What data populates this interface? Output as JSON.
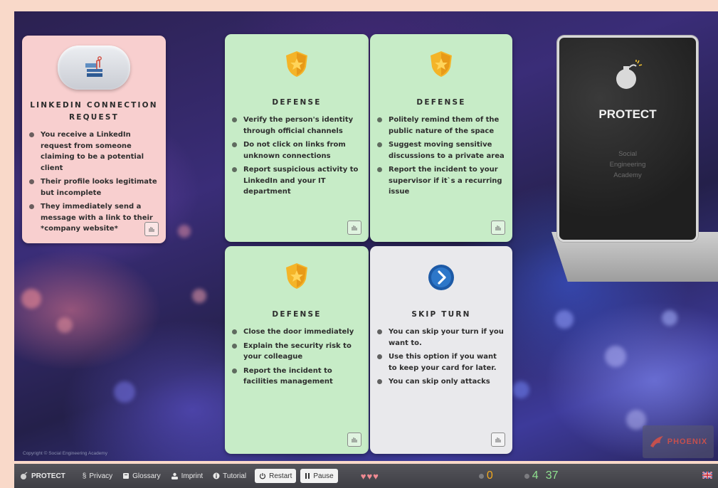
{
  "cards": {
    "attack": {
      "title": "LINKEDIN CONNECTION REQUEST",
      "bullets": [
        "You receive a LinkedIn request from someone claiming to be a potential client",
        "Their profile looks legitimate but incomplete",
        "They immediately send a message with a link to their *company website*"
      ]
    },
    "defense1": {
      "title": "DEFENSE",
      "bullets": [
        "Verify the person's identity through official channels",
        "Do not click on links from unknown connections",
        "Report suspicious activity to LinkedIn and your IT department"
      ]
    },
    "defense2": {
      "title": "DEFENSE",
      "bullets": [
        "Politely remind them of the public nature of the space",
        "Suggest moving sensitive discussions to a private area",
        "Report the incident to your supervisor if it`s a recurring issue"
      ]
    },
    "defense3": {
      "title": "DEFENSE",
      "bullets": [
        "Close the door immediately",
        "Explain the security risk to your colleague",
        "Report the incident to facilities management"
      ]
    },
    "skip": {
      "title": "SKIP TURN",
      "bullets": [
        "You can skip your turn if you want to.",
        "Use this option if you want to keep your card for later.",
        "You can skip only attacks"
      ]
    }
  },
  "deck": {
    "title": "PROTECT",
    "subtitle_lines": [
      "Social",
      "Engineering",
      "Academy"
    ]
  },
  "footer": {
    "copyright": "Copyright © Social Engineering Academy",
    "logo_text": "PHOENIX"
  },
  "bottombar": {
    "brand": "PROTECT",
    "privacy": "Privacy",
    "glossary": "Glossary",
    "imprint": "Imprint",
    "tutorial": "Tutorial",
    "restart": "Restart",
    "pause": "Pause",
    "hearts": "♥♥♥",
    "score": "0",
    "cards_left": "4",
    "timer": "37"
  },
  "colors": {
    "defense_card": "#c7ecc7",
    "attack_card": "#f8cfcf",
    "skip_card": "#e9e9ec",
    "score": "#f2a81e",
    "counter": "#8fe08f",
    "hearts": "#f08a92"
  },
  "icons": {
    "attack": "linkedin-connection-icon",
    "defense": "shield-star-icon",
    "skip": "skip-arrow-icon",
    "deck": "bomb-icon",
    "play": "hand-play-icon"
  }
}
